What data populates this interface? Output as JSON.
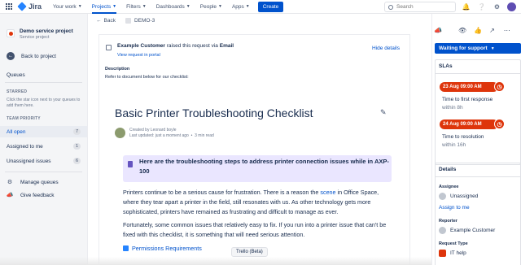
{
  "nav": {
    "logo": "Jira",
    "items": [
      "Your work",
      "Projects",
      "Filters",
      "Dashboards",
      "People",
      "Apps"
    ],
    "create_label": "Create",
    "search_placeholder": "Search",
    "icons": [
      "notifications-icon",
      "help-icon",
      "settings-icon",
      "avatar"
    ]
  },
  "sidebar": {
    "project_name": "Demo service project",
    "project_type": "Service project",
    "back_label": "Back to project",
    "queues_title": "Queues",
    "starred_heading": "STARRED",
    "starred_note": "Click the star icon next to your queues to add them here.",
    "priority_heading": "TEAM PRIORITY",
    "queues": [
      {
        "label": "All open",
        "count": "7"
      },
      {
        "label": "Assigned to me",
        "count": "1"
      },
      {
        "label": "Unassigned issues",
        "count": "6"
      }
    ],
    "manage_label": "Manage queues",
    "feedback_label": "Give feedback"
  },
  "breadcrumb": {
    "back_label": "Back",
    "issue_key": "DEMO-3"
  },
  "request": {
    "customer": "Example Customer",
    "raised_text": " raised this request via ",
    "channel": "Email",
    "view_link": "View request in portal",
    "hide_details": "Hide details",
    "description_label": "Description",
    "description_text": "Refer to document below for our checklist:"
  },
  "document": {
    "title": "Basic Printer Troubleshooting Checklist",
    "created_by": "Created by Leonard boyle",
    "updated": "Last updated: just a moment ago",
    "read_time": "3 min read",
    "note": "Here are the troubleshooting steps to address printer connection issues while in AXP-100",
    "para1_a": "Printers continue to be a serious cause for frustration. There is a reason the ",
    "para1_link": "scene",
    "para1_b": " in Office Space, where they tear apart a printer in the field, still resonates with us. As other technology gets more sophisticated, printers have remained as frustrating and difficult to manage as ever.",
    "para2": "Fortunately, some common issues that relatively easy to fix. If you run into a printer issue that can't be fixed with this checklist, it is something that will need serious attention.",
    "perm_link": "Permissions Requirements",
    "tooltip": "Trello (Beta)"
  },
  "right_panel": {
    "status": "Waiting for support",
    "slas_heading": "SLAs",
    "slas": [
      {
        "due": "23 Aug 09:00 AM",
        "name": "Time to first response",
        "within": "within 8h"
      },
      {
        "due": "24 Aug 09:00 AM",
        "name": "Time to resolution",
        "within": "within 16h"
      }
    ],
    "details_heading": "Details",
    "assignee_label": "Assignee",
    "assignee_value": "Unassigned",
    "assign_link": "Assign to me",
    "reporter_label": "Reporter",
    "reporter_value": "Example Customer",
    "request_type_label": "Request Type",
    "request_type_value": "IT help"
  },
  "colors": {
    "accent": "#0052cc",
    "sla_red": "#de350b",
    "note_bg": "#eae6ff"
  }
}
